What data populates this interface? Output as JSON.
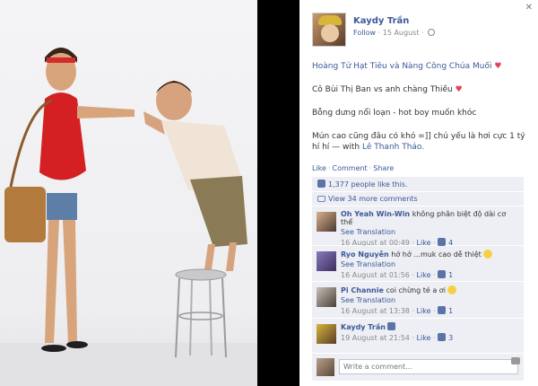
{
  "post": {
    "author": "Kaydy Trần",
    "follow_label": "Follow",
    "date": "15 August",
    "caption_lines": [
      "Hoàng Tử Hạt Tiêu và Nàng Công Chúa Muối",
      "Cô Bùi Thị Ban vs anh chàng Thiều",
      "Bỗng dưng nổi loạn - hot boy muốn khóc",
      "Mún cao cũng đâu có khó =]] chủ yếu là hơi cực 1 tý hí hí — with"
    ],
    "tagged_name": "Lê Thanh Thảo.",
    "actions": [
      "Like",
      "Comment",
      "Share"
    ],
    "likes_text": "1,377 people like this.",
    "view_more": "View 34 more comments"
  },
  "comments": [
    {
      "name": "Oh Yeah Win-Win",
      "text": "không phân biệt độ dài cơ thể",
      "translate": "See Translation",
      "time": "16 August at 00:49",
      "like": "Like",
      "count": "4"
    },
    {
      "name": "Ryo Nguyễn",
      "text": "hớ hớ ...muk cao dễ thiệt",
      "translate": "See Translation",
      "time": "16 August at 01:56",
      "like": "Like",
      "count": "1"
    },
    {
      "name": "Pi Channie",
      "text": "coi chừng té a ơi",
      "translate": "See Translation",
      "time": "16 August at 13:38",
      "like": "Like",
      "count": "1"
    },
    {
      "name": "Kaydy Trần",
      "text": "",
      "time": "19 August at 21:54",
      "like": "Like",
      "count": "3"
    }
  ],
  "compose": {
    "placeholder": "Write a comment..."
  },
  "colors": {
    "link": "#3b5998",
    "panel_bg": "#edeff4",
    "heart": "#e0405a"
  }
}
